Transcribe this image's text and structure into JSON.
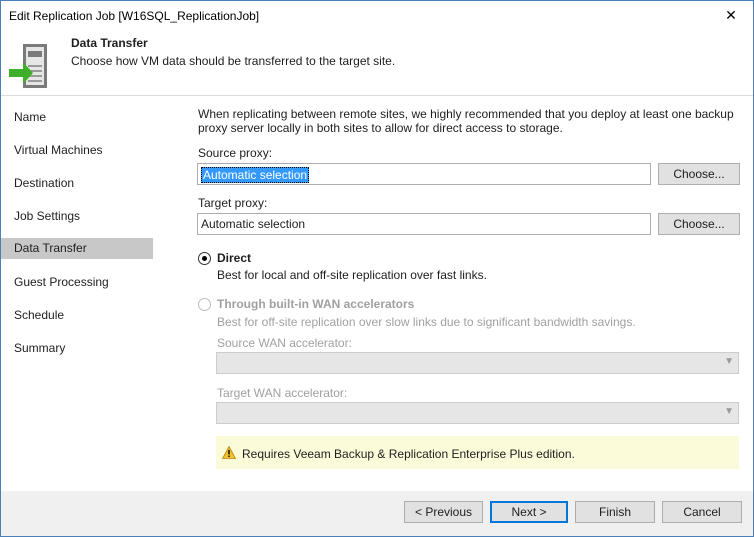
{
  "window": {
    "title": "Edit Replication Job [W16SQL_ReplicationJob]",
    "close_glyph": "✕"
  },
  "header": {
    "title": "Data Transfer",
    "description": "Choose how VM data should be transferred to the target site."
  },
  "sidebar": {
    "items": [
      {
        "label": "Name",
        "active": false
      },
      {
        "label": "Virtual Machines",
        "active": false
      },
      {
        "label": "Destination",
        "active": false
      },
      {
        "label": "Job Settings",
        "active": false
      },
      {
        "label": "Data Transfer",
        "active": true
      },
      {
        "label": "Guest Processing",
        "active": false
      },
      {
        "label": "Schedule",
        "active": false
      },
      {
        "label": "Summary",
        "active": false
      }
    ]
  },
  "main": {
    "intro_line1": "When replicating between remote sites, we highly recommended that you deploy at least one backup",
    "intro_line2": "proxy server locally in both sites to allow for direct access to storage.",
    "source_proxy": {
      "label": "Source proxy:",
      "value": "Automatic selection",
      "button": "Choose..."
    },
    "target_proxy": {
      "label": "Target proxy:",
      "value": "Automatic selection",
      "button": "Choose..."
    },
    "direct": {
      "title": "Direct",
      "description": "Best for local and off-site replication over fast links.",
      "selected": true
    },
    "wan": {
      "title": "Through built-in WAN accelerators",
      "description": "Best for off-site replication over slow links due to significant bandwidth savings.",
      "selected": false,
      "enabled": false,
      "source_label": "Source WAN accelerator:",
      "target_label": "Target WAN accelerator:",
      "source_value": "",
      "target_value": ""
    },
    "warning": "Requires Veeam Backup & Replication Enterprise Plus edition."
  },
  "footer": {
    "previous": "< Previous",
    "next": "Next >",
    "finish": "Finish",
    "cancel": "Cancel"
  },
  "colors": {
    "accent": "#0078d7",
    "selection": "#3399ff",
    "active_nav": "#c8c8c8",
    "warning_bg": "#fcfbd9"
  }
}
